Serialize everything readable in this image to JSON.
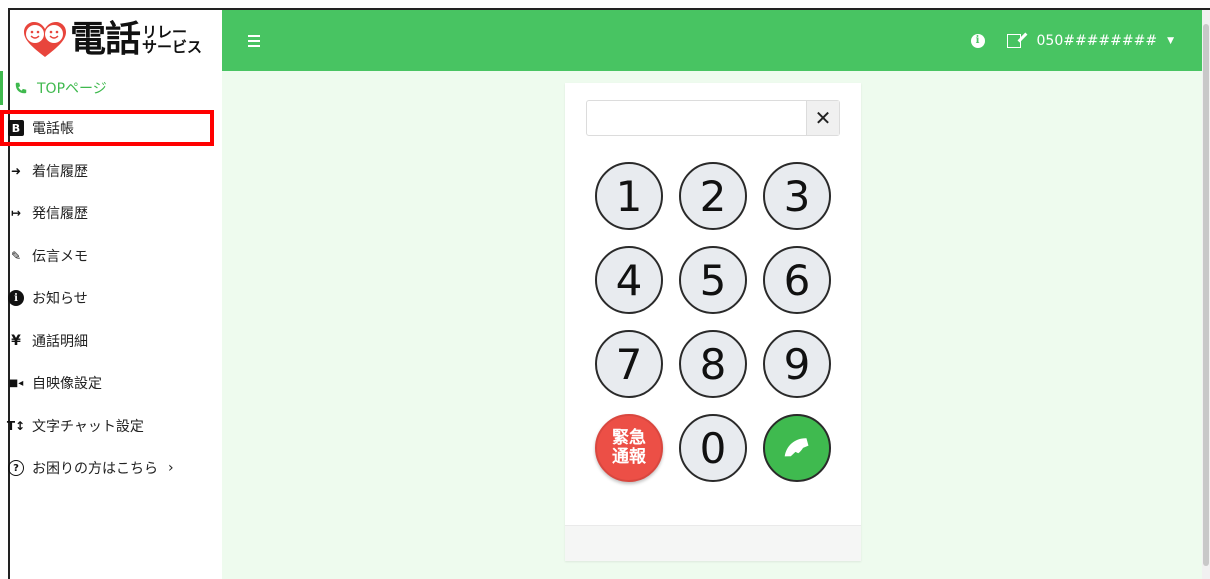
{
  "logo": {
    "main_text": "電話",
    "sub_top": "リレー",
    "sub_bottom": "サービス"
  },
  "sidebar": {
    "items": [
      {
        "label": "TOPページ",
        "icon": "phone-icon"
      },
      {
        "label": "電話帳",
        "icon": "address-book-icon"
      },
      {
        "label": "着信履歴",
        "icon": "sign-in-icon"
      },
      {
        "label": "発信履歴",
        "icon": "sign-out-icon"
      },
      {
        "label": "伝言メモ",
        "icon": "edit-icon"
      },
      {
        "label": "お知らせ",
        "icon": "info-icon"
      },
      {
        "label": "通話明細",
        "icon": "yen-icon"
      },
      {
        "label": "自映像設定",
        "icon": "video-icon"
      },
      {
        "label": "文字チャット設定",
        "icon": "text-height-icon"
      },
      {
        "label": "お困りの方はこちら",
        "icon": "question-circle-icon"
      }
    ],
    "icon_glyphs": {
      "address_book": "B",
      "sign_in": "➜",
      "sign_out": "↦",
      "edit": "✎",
      "info": "i",
      "yen": "¥",
      "video": "■◂",
      "text_height": "T↕",
      "question": "?",
      "chevron": "›"
    }
  },
  "topbar": {
    "info_glyph": "i",
    "account_number": "050########",
    "caret": "▼"
  },
  "dialer": {
    "input_value": "",
    "clear_glyph": "✕",
    "keys": [
      "1",
      "2",
      "3",
      "4",
      "5",
      "6",
      "7",
      "8",
      "9"
    ],
    "zero": "0",
    "emergency_line1": "緊急",
    "emergency_line2": "通報"
  },
  "colors": {
    "brand_green": "#48c462",
    "active_green": "#3fb94e",
    "content_bg": "#eefbee",
    "emergency_red": "#ec4f46",
    "call_green": "#3fba4f",
    "highlight_red": "#ff0000"
  }
}
